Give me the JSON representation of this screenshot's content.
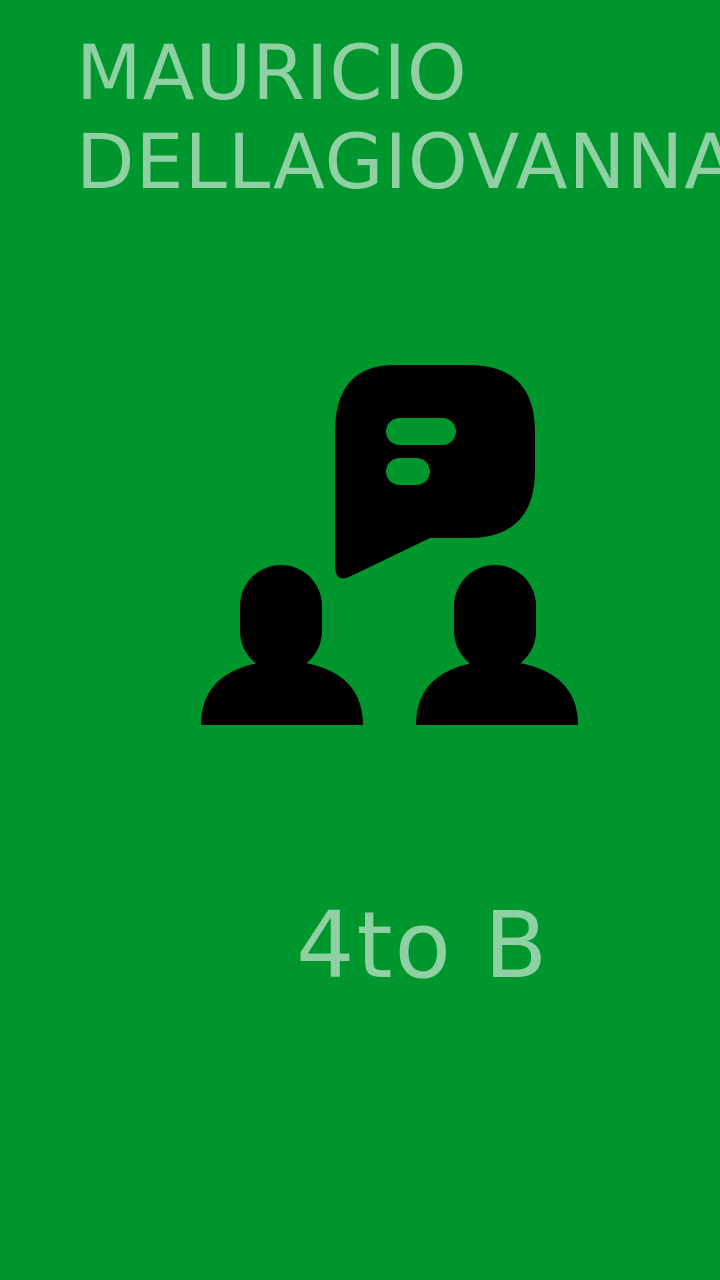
{
  "header": {
    "name_line1": "MAURICIO",
    "name_line2": "DELLAGIOVANNA"
  },
  "main": {
    "icon": "group-chat-icon",
    "class_label": "4to B"
  },
  "colors": {
    "background": "#00962e",
    "text": "#8fd1a3",
    "icon": "#000000"
  }
}
